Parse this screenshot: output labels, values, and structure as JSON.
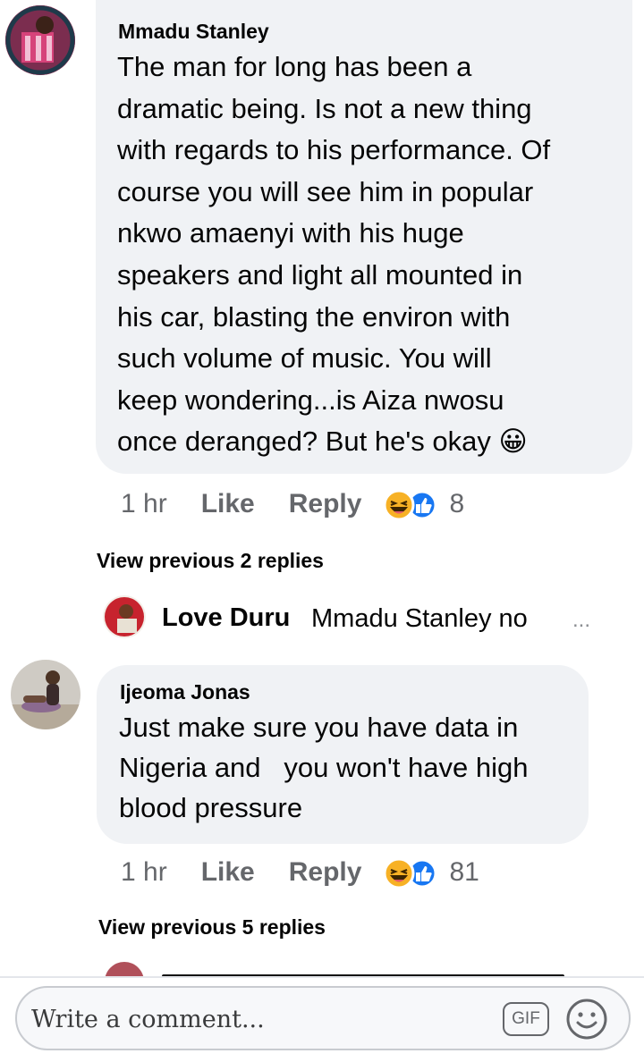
{
  "comments": [
    {
      "author": "Mmadu Stanley",
      "text_lines": [
        "The man for long has been a",
        "dramatic being. Is not a new thing",
        "with regards to his performance. Of",
        "course you will see him in popular",
        "nkwo amaenyi with his huge",
        "speakers and light all mounted in",
        "his car, blasting the environ with",
        "such volume of music. You will",
        "keep wondering...is Aiza nwosu",
        "once deranged? But he's okay 😀"
      ],
      "time": "1 hr",
      "like_label": "Like",
      "reply_label": "Reply",
      "reaction_count": "8",
      "view_previous": "View previous 2 replies",
      "reply_preview": {
        "author": "Love Duru",
        "text": "Mmadu Stanley no",
        "ellipsis": "..."
      }
    },
    {
      "author": "Ijeoma Jonas",
      "text_lines": [
        "Just make sure you have data in",
        "Nigeria and   you won't have high",
        "blood pressure"
      ],
      "time": "1 hr",
      "like_label": "Like",
      "reply_label": "Reply",
      "reaction_count": "81",
      "view_previous": "View previous 5 replies"
    }
  ],
  "composer": {
    "placeholder": "Write a comment...",
    "gif_label": "GIF"
  },
  "colors": {
    "bubble": "#f0f2f5",
    "meta": "#65676b",
    "like_blue": "#1877f2",
    "haha_yellow": "#f7b125"
  }
}
